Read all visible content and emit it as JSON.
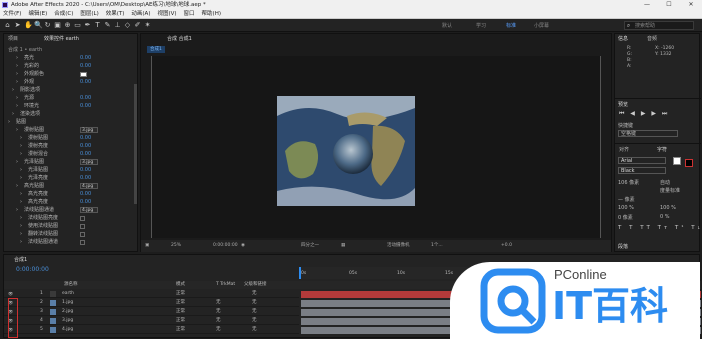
{
  "window": {
    "title": "Adobe After Effects 2020 - C:\\Users\\OM\\Desktop\\AE练习\\地球\\地球.aep *",
    "min": "—",
    "max": "☐",
    "close": "✕"
  },
  "menu": [
    "文件(F)",
    "编辑(E)",
    "合成(C)",
    "图层(L)",
    "效果(T)",
    "动画(A)",
    "视图(V)",
    "窗口",
    "帮助(H)"
  ],
  "workspaces": {
    "default": "默认",
    "learn": "学习",
    "standard": "标准",
    "small": "小屏幕"
  },
  "search": {
    "placeholder": "搜索帮助"
  },
  "project_panel": {
    "tab_project": "项目",
    "tab_effects": "效果控件 earth",
    "breadcrumb": "合成 1 • earth",
    "rows": [
      {
        "indent": 10,
        "label": "亮光",
        "value": "0.00"
      },
      {
        "indent": 10,
        "label": "光彩的",
        "value": "0.00"
      },
      {
        "indent": 10,
        "label": "外观颜色",
        "value": ""
      },
      {
        "indent": 10,
        "label": "外观",
        "value": "0.00"
      },
      {
        "indent": 6,
        "label": "阴影选项",
        "value": ""
      },
      {
        "indent": 10,
        "label": "光源",
        "value": "0.00"
      },
      {
        "indent": 10,
        "label": "环境光",
        "value": "0.00"
      },
      {
        "indent": 6,
        "label": "渲染选项",
        "value": ""
      },
      {
        "indent": 2,
        "label": "贴图",
        "value": ""
      },
      {
        "indent": 10,
        "label": "漫射贴图",
        "value": "3.jpg"
      },
      {
        "indent": 14,
        "label": "漫射贴图",
        "value": "0.00"
      },
      {
        "indent": 14,
        "label": "漫射亮度",
        "value": "0.00"
      },
      {
        "indent": 14,
        "label": "漫射混合",
        "value": "0.00"
      },
      {
        "indent": 10,
        "label": "光泽贴图",
        "value": "3.jpg"
      },
      {
        "indent": 14,
        "label": "光泽贴图",
        "value": "0.00"
      },
      {
        "indent": 14,
        "label": "光泽亮度",
        "value": "0.00"
      },
      {
        "indent": 10,
        "label": "高光贴图",
        "value": "4.jpg"
      },
      {
        "indent": 14,
        "label": "高光亮度",
        "value": "0.00"
      },
      {
        "indent": 14,
        "label": "高光亮度",
        "value": "0.00"
      },
      {
        "indent": 10,
        "label": "法线贴图通道",
        "value": "4.jpg"
      },
      {
        "indent": 14,
        "label": "法线贴图亮度",
        "value": ""
      },
      {
        "indent": 14,
        "label": "使用法线贴图",
        "value": ""
      },
      {
        "indent": 14,
        "label": "翻转法线贴图",
        "value": ""
      },
      {
        "indent": 14,
        "label": "法线贴图通道",
        "value": ""
      }
    ]
  },
  "viewer": {
    "tab": "合成 合成1",
    "breadcrumb": "合成1",
    "zoom": "25%",
    "timecode": "0:00:00:00",
    "quality": "四分之一",
    "camera": "活动摄像机",
    "views": "1个...",
    "exposure": "+0.0"
  },
  "info_panel": {
    "tab1": "信息",
    "tab2": "音频",
    "r": "R:",
    "g": "G:",
    "b": "B:",
    "a": "A:",
    "x": "X: -1260",
    "y": "Y: 1332"
  },
  "preview_panel": {
    "tab": "预览",
    "shortcut": "快捷键",
    "shortcut_val": "空格键"
  },
  "character_panel": {
    "tab1": "对齐",
    "tab2": "字符",
    "font": "Arial",
    "style": "Black",
    "size": "106 像素",
    "leading": "自动",
    "tracking": "度量标准",
    "stroke": "— 像素",
    "scale_v": "100 %",
    "scale_h": "100 %",
    "baseline": "0 像素",
    "tsume": "0 %",
    "para_tab": "段落"
  },
  "timeline": {
    "tab": "合成1",
    "timecode": "0:00:00:00",
    "headers": {
      "source": "源名称",
      "mode": "模式",
      "trkmat": "T TrkMat",
      "parent": "父级和链接"
    },
    "ruler": [
      "0s",
      "05s",
      "10s",
      "15s"
    ],
    "layers": [
      {
        "num": "1",
        "name": "earth",
        "mode": "正常",
        "trk": "",
        "parent": "无"
      },
      {
        "num": "2",
        "name": "1.jpg",
        "mode": "正常",
        "trk": "无",
        "parent": "无"
      },
      {
        "num": "3",
        "name": "2.jpg",
        "mode": "正常",
        "trk": "无",
        "parent": "无"
      },
      {
        "num": "4",
        "name": "3.jpg",
        "mode": "正常",
        "trk": "无",
        "parent": "无"
      },
      {
        "num": "5",
        "name": "4.jpg",
        "mode": "正常",
        "trk": "无",
        "parent": "无"
      }
    ]
  },
  "watermark": {
    "brand": "PConline",
    "name": "IT百科"
  },
  "colors": {
    "accent": "#2d8cf0",
    "bar_red": "#b33a3a",
    "bar_gray": "#7a7e85",
    "watermark_blue": "#2d8cf0"
  }
}
